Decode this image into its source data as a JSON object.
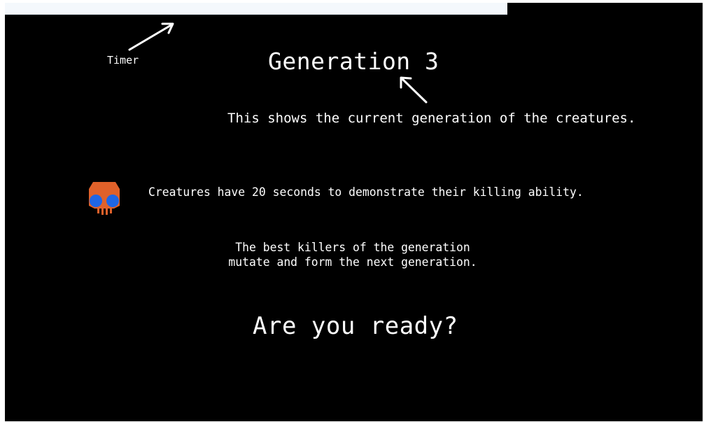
{
  "timer": {
    "label": "Timer",
    "remaining_fraction": 0.72
  },
  "generation": {
    "title": "Generation 3",
    "description": "This shows the current generation of the creatures."
  },
  "creatures": {
    "description": "Creatures have 20 seconds to demonstrate their killing ability.",
    "icon": "creature-icon",
    "colors": {
      "body": "#e0612a",
      "eyes": "#1f66e5"
    }
  },
  "evolution": {
    "line1": "The best killers of the generation",
    "line2": "mutate and form the next generation."
  },
  "prompt": {
    "ready": "Are you ready?"
  },
  "annotations": {
    "arrow_icon": "arrow-icon",
    "arrow_color": "#ffffff"
  }
}
